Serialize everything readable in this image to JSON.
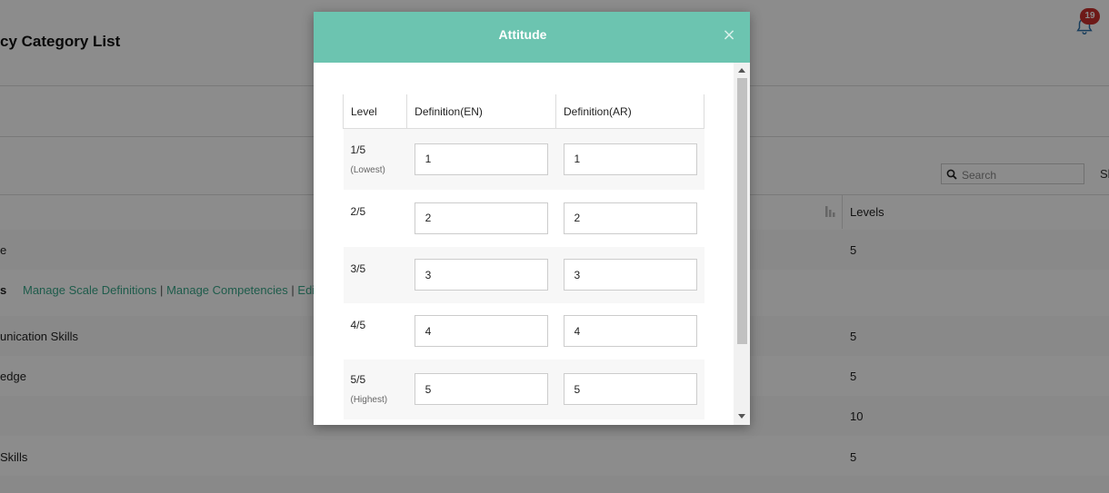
{
  "page": {
    "title": "cy Category List",
    "notifications_count": "19",
    "search_placeholder": "Search",
    "cut_label": "Sh",
    "levels_header": "Levels",
    "rows": [
      {
        "name": "e",
        "levels": "5"
      },
      {
        "name": "s",
        "links": [
          "Manage Scale Definitions",
          "Manage Competencies",
          "Edit"
        ],
        "levels": ""
      },
      {
        "name": "unication Skills",
        "levels": "5"
      },
      {
        "name": "edge",
        "levels": "5"
      },
      {
        "name": "",
        "levels": "10"
      },
      {
        "name": "Skills",
        "levels": "5"
      }
    ],
    "link_separator": "|"
  },
  "modal": {
    "title": "Attitude",
    "close_glyph": "×",
    "columns": [
      "Level",
      "Definition(EN)",
      "Definition(AR)"
    ],
    "levels": [
      {
        "level": "1/5",
        "note": "(Lowest)",
        "en": "1",
        "ar": "1"
      },
      {
        "level": "2/5",
        "note": "",
        "en": "2",
        "ar": "2"
      },
      {
        "level": "3/5",
        "note": "",
        "en": "3",
        "ar": "3"
      },
      {
        "level": "4/5",
        "note": "",
        "en": "4",
        "ar": "4"
      },
      {
        "level": "5/5",
        "note": "(Highest)",
        "en": "5",
        "ar": "5"
      }
    ]
  },
  "colors": {
    "modal_header": "#6cc4b0",
    "link": "#3aa88a",
    "badge": "#c9302c"
  },
  "icons": [
    "bell-icon",
    "search-icon",
    "sort-icon",
    "close-icon"
  ]
}
